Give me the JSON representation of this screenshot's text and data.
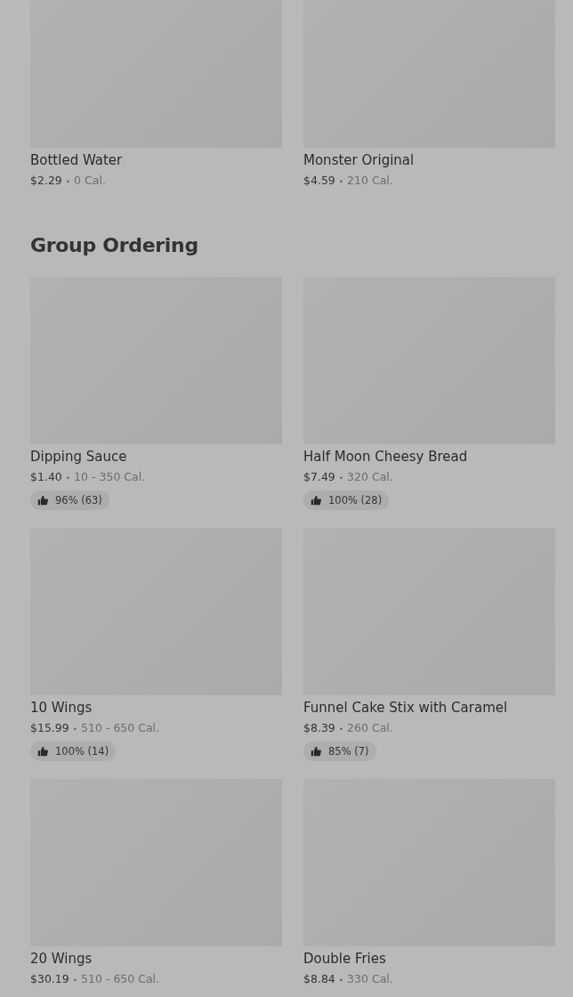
{
  "sections": [
    {
      "items": [
        {
          "name": "Bottled Water",
          "price": "$2.29",
          "separator": "•",
          "calories": "0 Cal."
        },
        {
          "name": "Monster Original",
          "price": "$4.59",
          "separator": "•",
          "calories": "210 Cal."
        }
      ]
    },
    {
      "title": "Group Ordering",
      "items": [
        {
          "name": "Dipping Sauce",
          "price": "$1.40",
          "separator": "•",
          "calories": "10 - 350 Cal.",
          "rating": "96% (63)"
        },
        {
          "name": "Half Moon Cheesy Bread",
          "price": "$7.49",
          "separator": "•",
          "calories": "320 Cal.",
          "rating": "100% (28)"
        },
        {
          "name": "10 Wings",
          "price": "$15.99",
          "separator": "•",
          "calories": "510 - 650 Cal.",
          "rating": "100% (14)"
        },
        {
          "name": "Funnel Cake Stix with Caramel",
          "price": "$8.39",
          "separator": "•",
          "calories": "260 Cal.",
          "rating": "85% (7)"
        },
        {
          "name": "20 Wings",
          "price": "$30.19",
          "separator": "•",
          "calories": "510 - 650 Cal."
        },
        {
          "name": "Double Fries",
          "price": "$8.84",
          "separator": "•",
          "calories": "330 Cal."
        }
      ]
    }
  ]
}
